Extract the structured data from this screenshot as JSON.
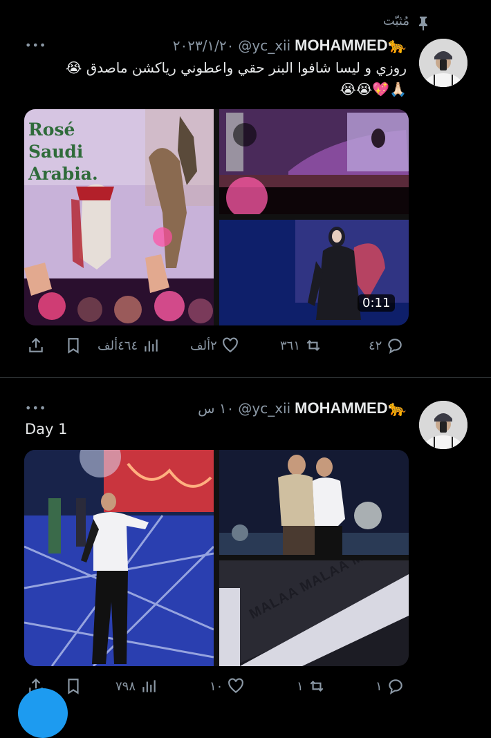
{
  "pinned_label": "مُثبّت",
  "tweets": [
    {
      "name": "MOHAMMED🐆",
      "handle": "@yc_xii",
      "time": "٢٠٢٣/١/٢٠",
      "text": "روزي و ليسا شافوا البنر حقي واعطوني رياكشن ماصدق 😭",
      "text2": "🙏🏻💖😭😭",
      "media_sign": "Rosé Saudi Arabia.",
      "video_duration": "0:11",
      "counts": {
        "replies": "٤٢",
        "retweets": "٣٦١",
        "likes": "٢ألف",
        "views": "٤٦٤ألف"
      }
    },
    {
      "name": "MOHAMMED🐆",
      "handle": "@yc_xii",
      "time": "١٠ س",
      "text": "Day 1",
      "banner_text": "MALAA MALAA MALAA",
      "counts": {
        "replies": "١",
        "retweets": "١",
        "likes": "١٠",
        "views": "٧٩٨"
      }
    }
  ],
  "colors": {
    "background": "#000000",
    "text": "#e7e9ea",
    "muted": "#8b98a5",
    "divider": "#2f3336",
    "fab": "#1d9bf0"
  }
}
